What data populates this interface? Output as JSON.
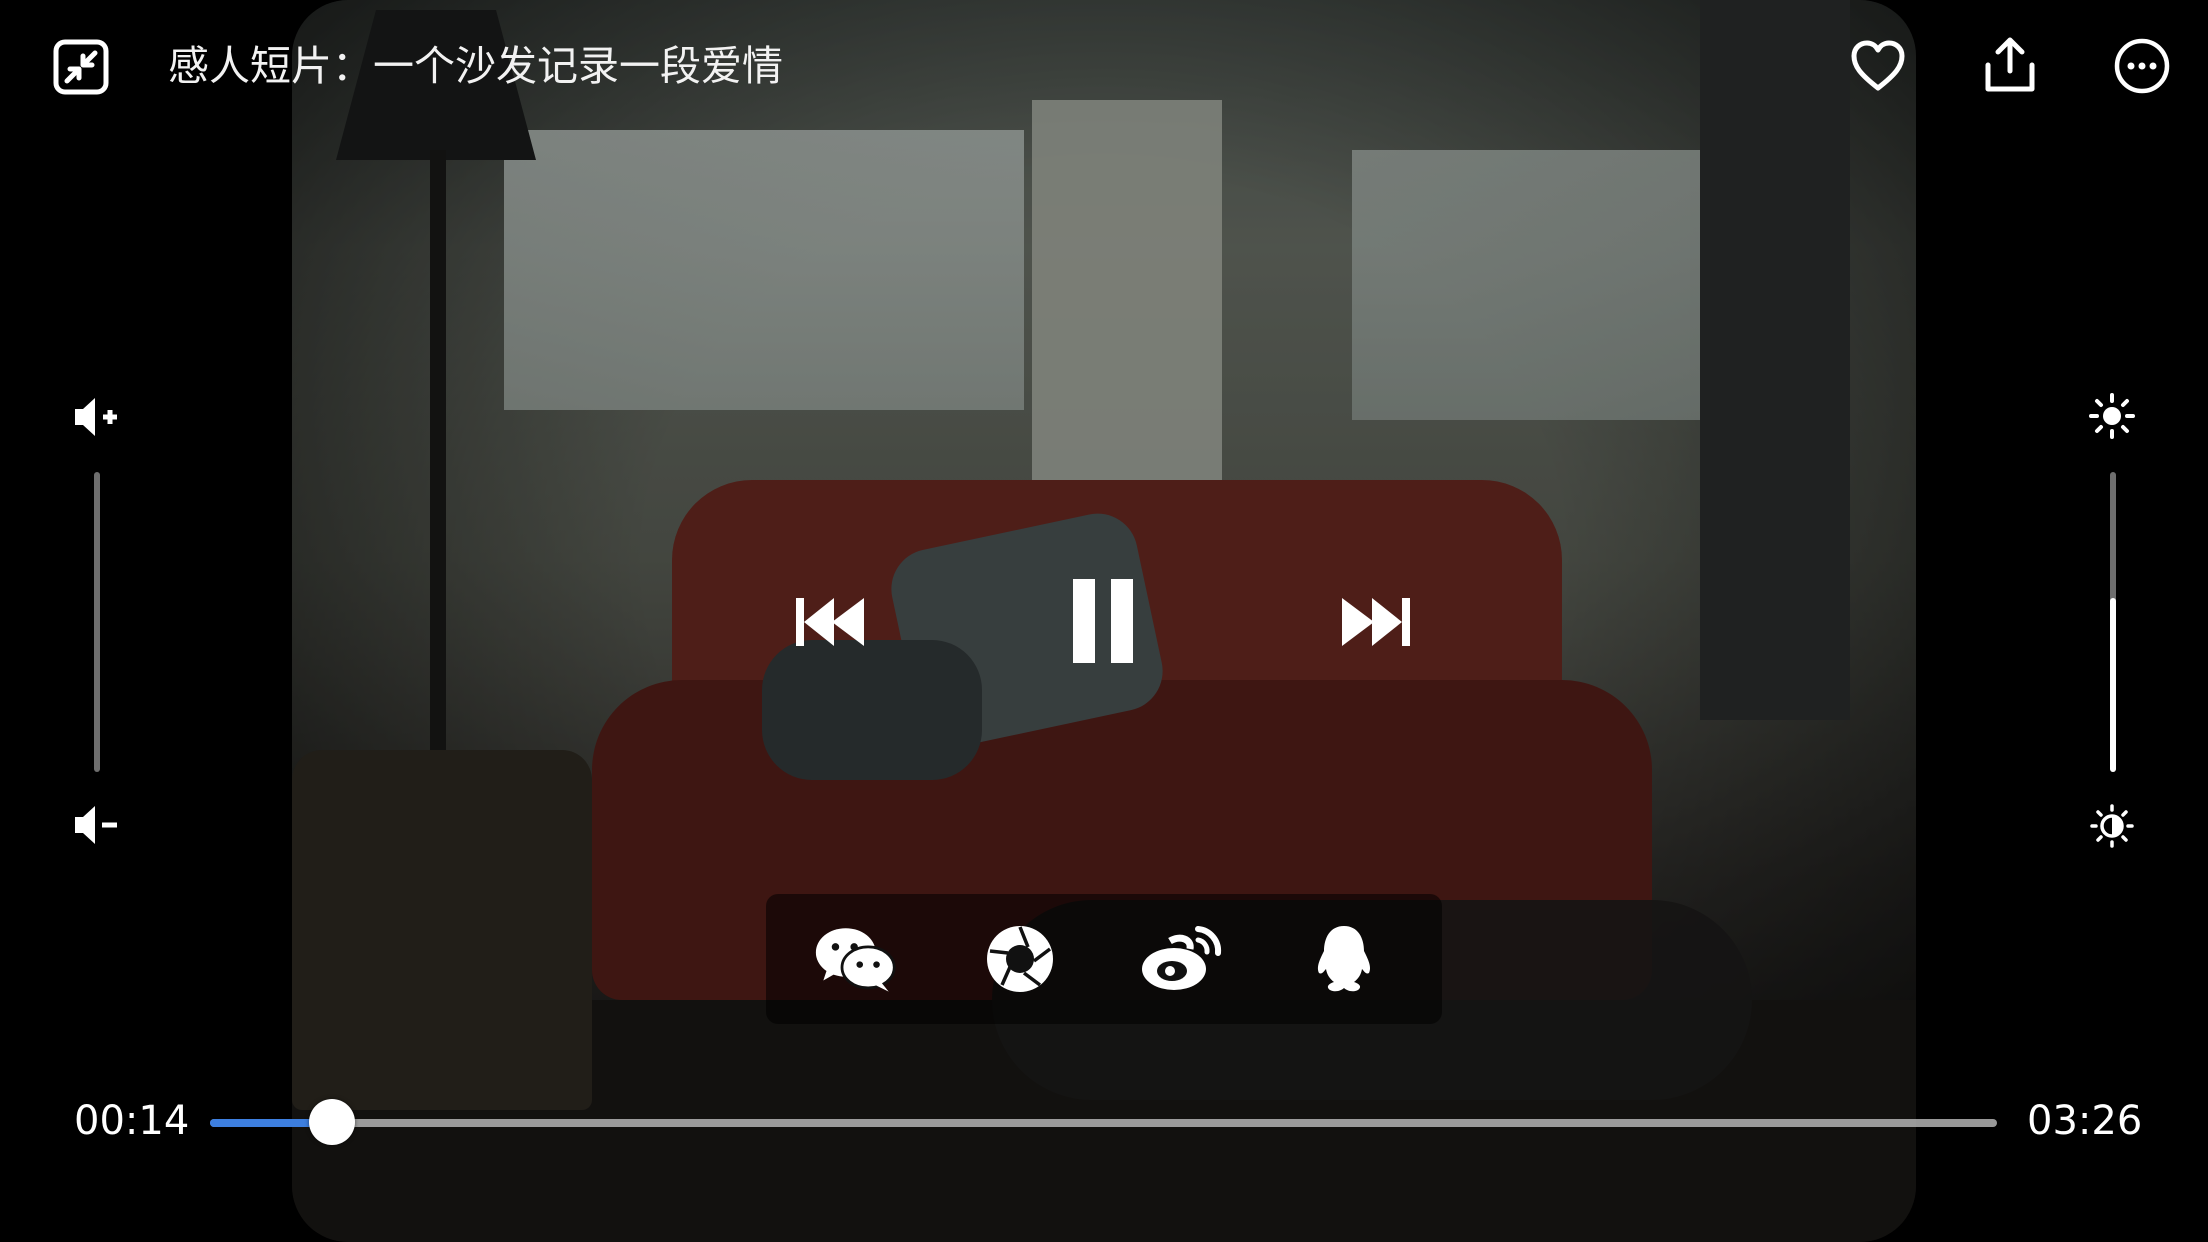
{
  "video": {
    "title": "感人短片：一个沙发记录一段爱情",
    "current_time": "00:14",
    "total_time": "03:26",
    "progress_fraction": 0.068,
    "volume_fraction": 0.0,
    "brightness_fraction": 0.58,
    "state": "playing"
  },
  "top_bar": {
    "exit_fullscreen_icon": "shrink-icon",
    "favorite_icon": "heart-icon",
    "share_icon": "share-upload-icon",
    "more_icon": "more-dots-icon"
  },
  "playback_controls": {
    "previous_icon": "skip-previous-icon",
    "pause_icon": "pause-icon",
    "next_icon": "skip-next-icon"
  },
  "share_targets": [
    "wechat-icon",
    "moments-icon",
    "weibo-icon",
    "qq-icon"
  ],
  "colors": {
    "progress": "#3d7fe0",
    "track": "#bebebe",
    "icon": "#ffffff",
    "background": "#000000"
  }
}
